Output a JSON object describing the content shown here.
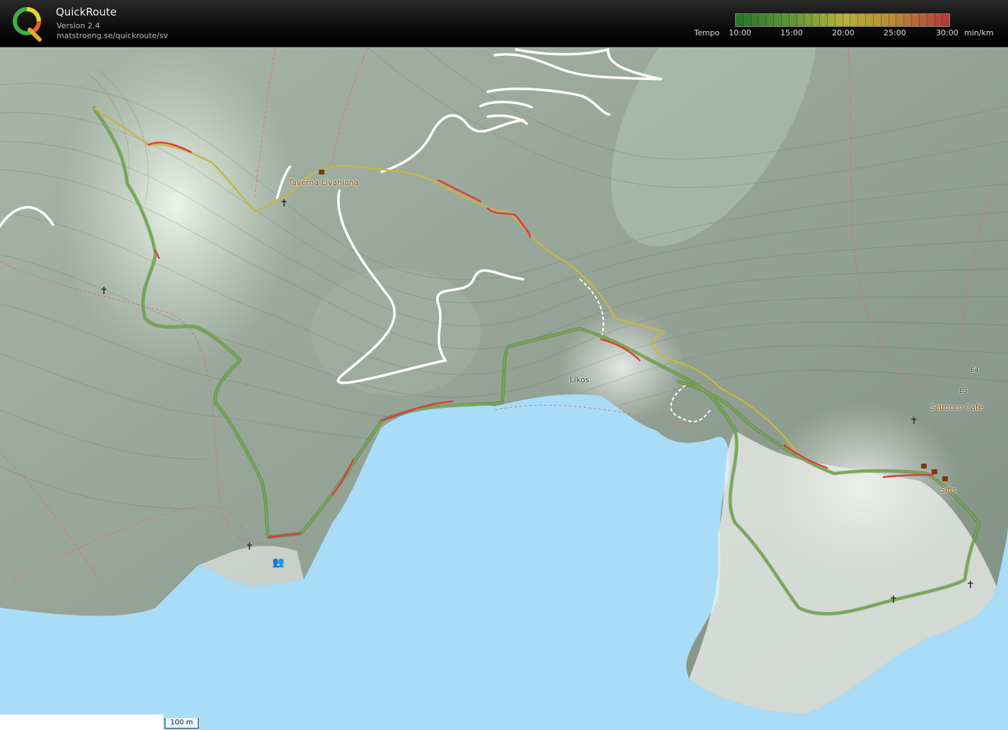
{
  "app": {
    "title": "QuickRoute",
    "version": "Version 2.4",
    "url": "matstroeng.se/quickroute/sv"
  },
  "legend": {
    "title": "Tempo",
    "ticks": [
      "10:00",
      "15:00",
      "20:00",
      "25:00",
      "30:00"
    ],
    "unit": "min/km",
    "colors": [
      "#2f9a2f",
      "#7ac143",
      "#e8e84a",
      "#f0b040",
      "#e84a4a"
    ]
  },
  "map": {
    "places": {
      "taverna": "Taverna Livaniana",
      "likos": "Likos",
      "scirocco": "Scirocco Café",
      "sifis": "Sifis",
      "road_e3": "E3",
      "road_e4": "E4"
    },
    "scale_label": "100 m",
    "colors": {
      "sea": "#a9dcf7",
      "land": "#8a9a8e",
      "route_fast": "#3a8a3a",
      "route_slow": "#d94040"
    }
  }
}
